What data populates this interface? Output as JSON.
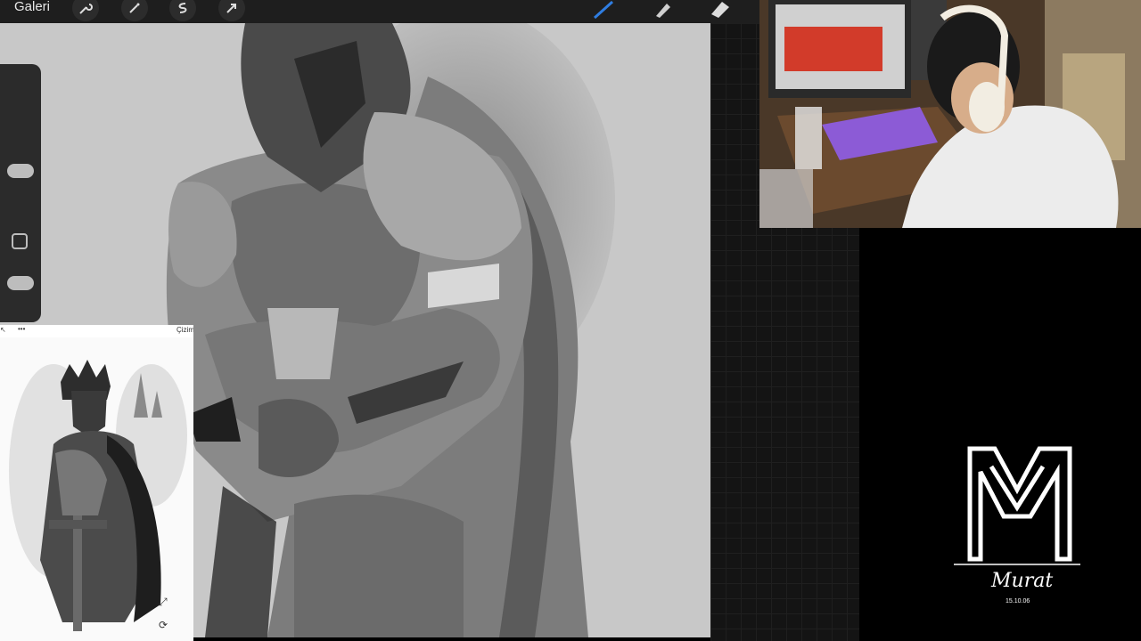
{
  "toolbar": {
    "gallery_label": "Galeri",
    "left_tools": [
      "wrench-icon",
      "magic-wand-icon",
      "selection-icon",
      "move-arrow-icon"
    ],
    "right_tools": [
      "brush-icon",
      "smudge-icon",
      "eraser-icon"
    ],
    "accent_color": "#2f7de1"
  },
  "reference": {
    "header_label": "Çizim",
    "menu_glyph": "•••"
  },
  "branding": {
    "signature": "Murat",
    "signature_date": "15.10.06"
  }
}
